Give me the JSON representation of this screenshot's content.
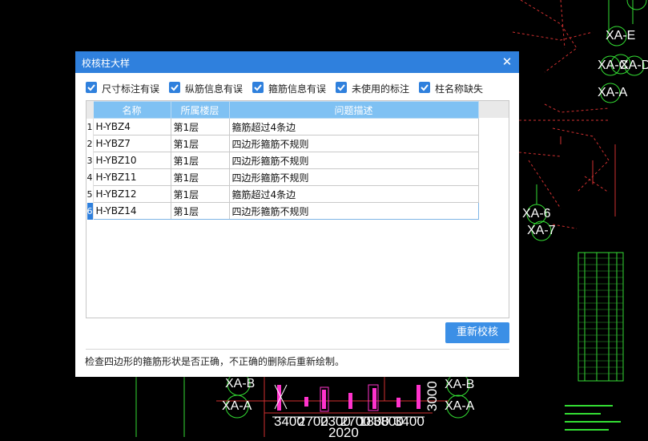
{
  "dialog": {
    "title": "校核柱大样",
    "close_glyph": "✕",
    "filters": [
      {
        "label": "尺寸标注有误",
        "checked": true
      },
      {
        "label": "纵筋信息有误",
        "checked": true
      },
      {
        "label": "箍筋信息有误",
        "checked": true
      },
      {
        "label": "未使用的标注",
        "checked": true
      },
      {
        "label": "柱名称缺失",
        "checked": true
      }
    ],
    "table": {
      "columns": [
        "名称",
        "所属楼层",
        "问题描述"
      ],
      "rows": [
        {
          "no": "1",
          "name": "H-YBZ4",
          "floor": "第1层",
          "issue": "箍筋超过4条边"
        },
        {
          "no": "2",
          "name": "H-YBZ7",
          "floor": "第1层",
          "issue": "四边形箍筋不规则"
        },
        {
          "no": "3",
          "name": "H-YBZ10",
          "floor": "第1层",
          "issue": "四边形箍筋不规则"
        },
        {
          "no": "4",
          "name": "H-YBZ11",
          "floor": "第1层",
          "issue": "四边形箍筋不规则"
        },
        {
          "no": "5",
          "name": "H-YBZ12",
          "floor": "第1层",
          "issue": "箍筋超过4条边"
        },
        {
          "no": "6",
          "name": "H-YBZ14",
          "floor": "第1层",
          "issue": "四边形箍筋不规则"
        }
      ],
      "selected_row": 5
    },
    "recheck_button": "重新校核",
    "hint": "检查四边形的箍筋形状是否正确，不正确的删除后重新绘制。"
  },
  "cad": {
    "labels": [
      "XA-E",
      "XA-D",
      "XA-C",
      "XA-A",
      "XA-6",
      "XA-7",
      "XA-B",
      "XA-A",
      "XA-B",
      "XA-A"
    ],
    "dims": [
      "3400",
      "2700",
      "2300",
      "2700",
      "1800",
      "3800",
      "3400",
      "2020",
      "3000"
    ]
  },
  "colors": {
    "accent": "#2f80dd",
    "header": "#7fc1f3",
    "cad_red": "#d03030",
    "cad_green": "#33dd33",
    "cad_magenta": "#ff33cc"
  }
}
